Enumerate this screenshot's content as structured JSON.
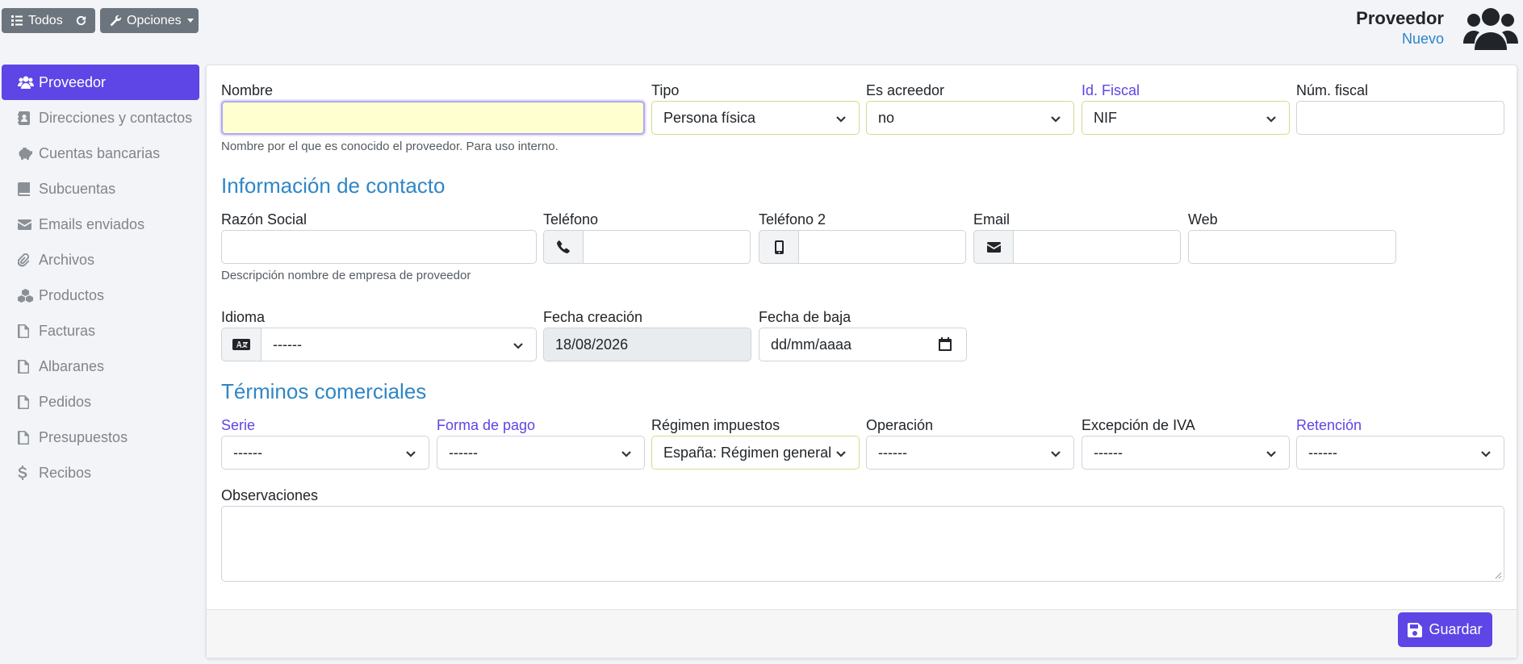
{
  "toolbar": {
    "all_label": "Todos",
    "options_label": "Opciones"
  },
  "header": {
    "title": "Proveedor",
    "subtitle": "Nuevo",
    "icon": "users-icon"
  },
  "sidebar": {
    "items": [
      {
        "label": "Proveedor",
        "icon": "users-icon",
        "active": true
      },
      {
        "label": "Direcciones y contactos",
        "icon": "address-book-icon"
      },
      {
        "label": "Cuentas bancarias",
        "icon": "piggy-bank-icon"
      },
      {
        "label": "Subcuentas",
        "icon": "book-icon"
      },
      {
        "label": "Emails enviados",
        "icon": "envelope-icon"
      },
      {
        "label": "Archivos",
        "icon": "paperclip-icon"
      },
      {
        "label": "Productos",
        "icon": "cubes-icon"
      },
      {
        "label": "Facturas",
        "icon": "file-icon"
      },
      {
        "label": "Albaranes",
        "icon": "file-icon"
      },
      {
        "label": "Pedidos",
        "icon": "file-icon"
      },
      {
        "label": "Presupuestos",
        "icon": "file-icon"
      },
      {
        "label": "Recibos",
        "icon": "dollar-icon"
      }
    ]
  },
  "form": {
    "nombre": {
      "label": "Nombre",
      "value": "",
      "help": "Nombre por el que es conocido el proveedor. Para uso interno."
    },
    "tipo": {
      "label": "Tipo",
      "value": "Persona física"
    },
    "acreedor": {
      "label": "Es acreedor",
      "value": "no"
    },
    "idfiscal": {
      "label": "Id. Fiscal",
      "value": "NIF"
    },
    "numfiscal": {
      "label": "Núm. fiscal",
      "value": ""
    },
    "contact_section": "Información de contacto",
    "razon": {
      "label": "Razón Social",
      "value": "",
      "help": "Descripción nombre de empresa de proveedor"
    },
    "telefono": {
      "label": "Teléfono",
      "value": ""
    },
    "telefono2": {
      "label": "Teléfono 2",
      "value": ""
    },
    "email": {
      "label": "Email",
      "value": ""
    },
    "web": {
      "label": "Web",
      "value": ""
    },
    "idioma": {
      "label": "Idioma",
      "value": "------"
    },
    "fecha_creacion": {
      "label": "Fecha creación",
      "value": "18/08/2026"
    },
    "fecha_baja": {
      "label": "Fecha de baja",
      "value": "dd/mm/aaaa"
    },
    "terms_section": "Términos comerciales",
    "serie": {
      "label": "Serie",
      "value": "------"
    },
    "forma_pago": {
      "label": "Forma de pago",
      "value": "------"
    },
    "regimen": {
      "label": "Régimen impuestos",
      "value": "España: Régimen general"
    },
    "operacion": {
      "label": "Operación",
      "value": "------"
    },
    "excepcion": {
      "label": "Excepción de IVA",
      "value": "------"
    },
    "retencion": {
      "label": "Retención",
      "value": "------"
    },
    "observaciones": {
      "label": "Observaciones",
      "value": ""
    }
  },
  "footer": {
    "save_label": "Guardar"
  },
  "colors": {
    "accent": "#5d45e6",
    "section": "#2f86c6",
    "secondary_button": "#6c757d"
  }
}
